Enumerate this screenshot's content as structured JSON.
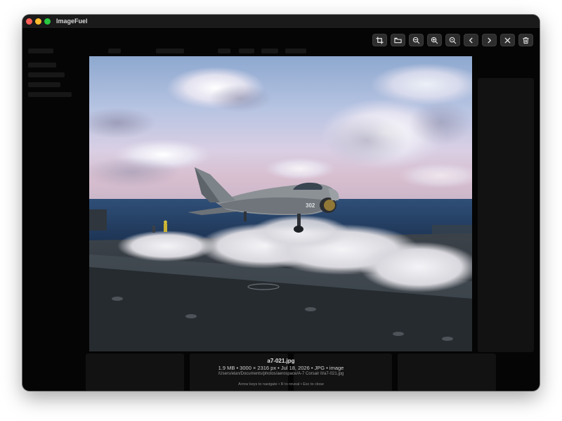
{
  "app": {
    "title": "ImageFuel"
  },
  "toolbar": {
    "buttons": [
      {
        "name": "crop-button",
        "icon": "crop-icon"
      },
      {
        "name": "folder-button",
        "icon": "folder-icon"
      },
      {
        "name": "zoom-out-button",
        "icon": "zoom-out-icon"
      },
      {
        "name": "zoom-in-button",
        "icon": "zoom-in-icon"
      },
      {
        "name": "zoom-fit-button",
        "icon": "zoom-fit-icon"
      },
      {
        "name": "previous-button",
        "icon": "chevron-left-icon"
      },
      {
        "name": "next-button",
        "icon": "chevron-right-icon"
      },
      {
        "name": "close-button",
        "icon": "close-icon"
      },
      {
        "name": "delete-button",
        "icon": "trash-icon"
      }
    ]
  },
  "image": {
    "filename": "a7-021.jpg",
    "meta": "1.9 MB • 3000 × 2316 px • Jul 18, 2026 • JPG • image",
    "path": "/Users/elan/Documents/photos/aerospace/A-7 Corsair II/a7-021.jpg",
    "aircraft_marking": "302"
  },
  "hints": {
    "text": "Arrow keys to navigate • R to reveal • Esc to close"
  },
  "colors": {
    "window_bg": "#050505",
    "titlebar": "#1a1a1a",
    "button_bg": "#2d2d2d",
    "close_dot": "#fe5f57",
    "minimize_dot": "#febc2e",
    "zoom_dot": "#28c840"
  }
}
